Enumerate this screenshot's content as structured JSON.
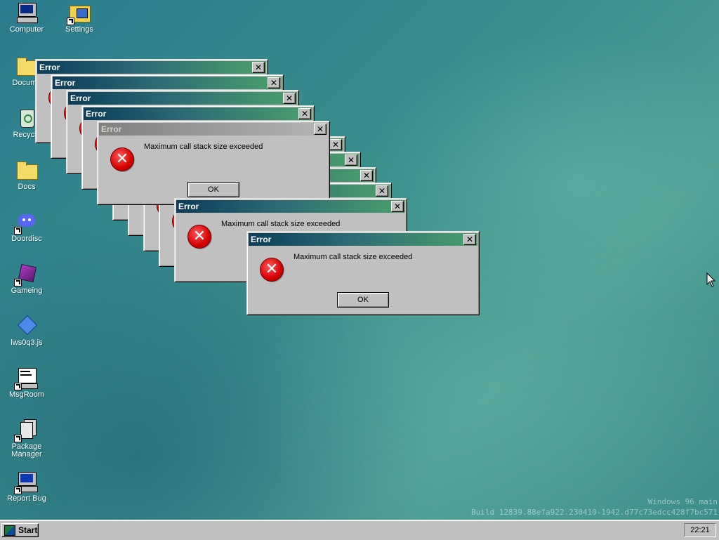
{
  "desktop": {
    "icons": [
      {
        "label": "Computer"
      },
      {
        "label": "Settings"
      },
      {
        "label": "Docume"
      },
      {
        "label": "Recycle"
      },
      {
        "label": "Docs"
      },
      {
        "label": "Doordisc"
      },
      {
        "label": "Gameing"
      },
      {
        "label": "lws0q3.js"
      },
      {
        "label": "MsgRoom"
      },
      {
        "label": "Package Manager"
      },
      {
        "label": "Report Bug"
      }
    ]
  },
  "dialogs": {
    "title": "Error",
    "message": "Maximum call stack size exceeded",
    "ok_label": "OK",
    "close_glyph": "✕",
    "icon_glyph": "✕"
  },
  "taskbar": {
    "start_label": "Start",
    "clock": "22:21"
  },
  "watermark": {
    "line1": "Windows 96 main",
    "line2": "Build 12839.88efa922.230410-1942.d77c73edcc428f7bc571"
  },
  "colors": {
    "titlebar_start": "#0b3d5a",
    "titlebar_end": "#4aa06c",
    "error_red": "#d40000",
    "desktop_teal": "#3a8f8c"
  }
}
